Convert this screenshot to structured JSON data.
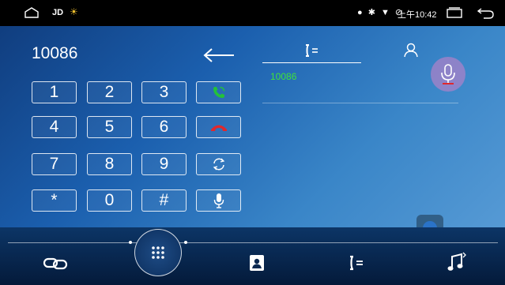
{
  "status_bar": {
    "app_label": "JD",
    "weather_icon": "sun-cloud-icon",
    "indicators": "● ✱ ▼ ⊘",
    "time": "上午10:42"
  },
  "dialer": {
    "number": "10086",
    "keys": [
      {
        "label": "1"
      },
      {
        "label": "2"
      },
      {
        "label": "3"
      },
      {
        "label": "4"
      },
      {
        "label": "5"
      },
      {
        "label": "6"
      },
      {
        "label": "7"
      },
      {
        "label": "8"
      },
      {
        "label": "9"
      },
      {
        "label": "*"
      },
      {
        "label": "0"
      },
      {
        "label": "#"
      }
    ]
  },
  "call_log": {
    "entries": [
      {
        "number": "10086"
      }
    ]
  },
  "colors": {
    "call_green": "#23c23a",
    "hangup_red": "#e0282d",
    "log_green": "#3fe23a"
  },
  "bottom_nav": {
    "items": [
      "link-icon",
      "dialpad-icon",
      "contacts-icon",
      "call-log-icon",
      "music-icon"
    ]
  }
}
